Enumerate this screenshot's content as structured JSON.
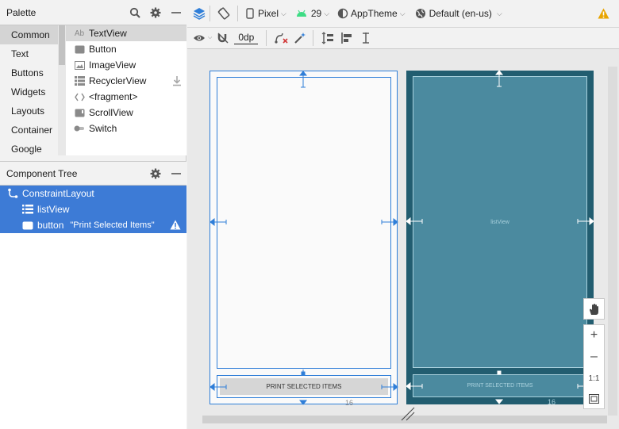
{
  "palette": {
    "title": "Palette",
    "categories": [
      "Common",
      "Text",
      "Buttons",
      "Widgets",
      "Layouts",
      "Container",
      "Google"
    ],
    "selected_category": "Common",
    "widgets": [
      {
        "label": "TextView",
        "icon": "textview-icon",
        "icon_text": "Ab"
      },
      {
        "label": "Button",
        "icon": "button-icon"
      },
      {
        "label": "ImageView",
        "icon": "imageview-icon"
      },
      {
        "label": "RecyclerView",
        "icon": "recyclerview-icon"
      },
      {
        "label": "<fragment>",
        "icon": "fragment-icon"
      },
      {
        "label": "ScrollView",
        "icon": "scrollview-icon"
      },
      {
        "label": "Switch",
        "icon": "switch-icon"
      }
    ]
  },
  "component_tree": {
    "title": "Component Tree",
    "items": [
      {
        "label": "ConstraintLayout",
        "icon": "constraint-layout-icon"
      },
      {
        "label": "listView",
        "icon": "list-icon"
      },
      {
        "label": "button",
        "detail": "\"Print Selected Items\"",
        "icon": "button-icon"
      }
    ]
  },
  "toolbar": {
    "device": "Pixel",
    "api": "29",
    "theme": "AppTheme",
    "locale": "Default (en-us)",
    "margin": "0dp"
  },
  "design": {
    "button_text": "PRINT SELECTED ITEMS",
    "list_label": "listView",
    "blueprint_button_text": "PRINT SELECTED ITEMS",
    "margin_label_left": "16",
    "margin_label_right": "16"
  },
  "zoom": {
    "one_to_one": "1:1"
  },
  "colors": {
    "selection_blue": "#3d7bd6",
    "blueprint_bg": "#225d70",
    "blueprint_fill": "#4b8a9f",
    "constraint_blue": "#2f7ed8",
    "warning": "#e8a400"
  }
}
